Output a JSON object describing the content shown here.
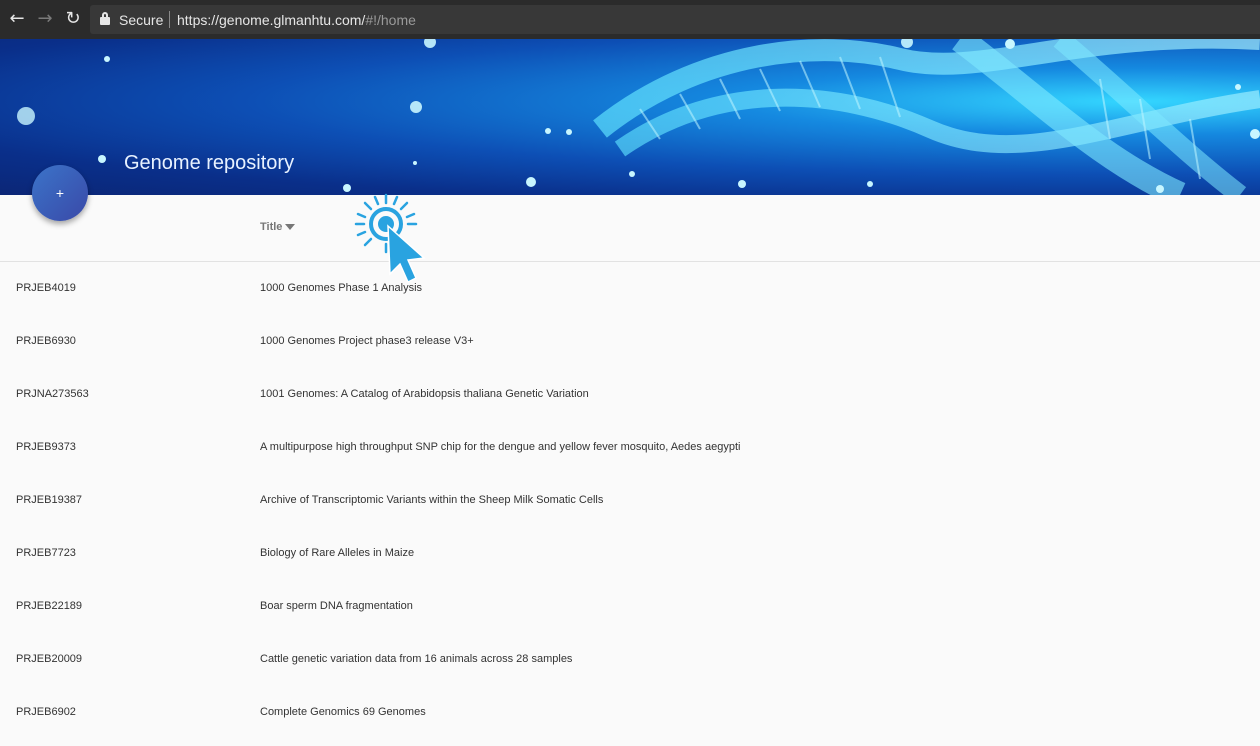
{
  "browser": {
    "secure_label": "Secure",
    "url_main": "https://genome.glmanhtu.com/",
    "url_hash": "#!/home"
  },
  "header": {
    "title": "Genome repository",
    "fab_label": "+"
  },
  "table": {
    "column_title": "Title",
    "rows": [
      {
        "id": "PRJEB4019",
        "title": "1000 Genomes Phase 1 Analysis"
      },
      {
        "id": "PRJEB6930",
        "title": "1000 Genomes Project phase3 release V3+"
      },
      {
        "id": "PRJNA273563",
        "title": "1001 Genomes: A Catalog of Arabidopsis thaliana Genetic Variation"
      },
      {
        "id": "PRJEB9373",
        "title": "A multipurpose high throughput SNP chip for the dengue and yellow fever mosquito, Aedes aegypti"
      },
      {
        "id": "PRJEB19387",
        "title": "Archive of Transcriptomic Variants within the Sheep Milk Somatic Cells"
      },
      {
        "id": "PRJEB7723",
        "title": "Biology of Rare Alleles in Maize"
      },
      {
        "id": "PRJEB22189",
        "title": "Boar sperm DNA fragmentation"
      },
      {
        "id": "PRJEB20009",
        "title": "Cattle genetic variation data from 16 animals across 28 samples"
      },
      {
        "id": "PRJEB6902",
        "title": "Complete Genomics 69 Genomes"
      }
    ]
  },
  "colors": {
    "banner_dark": "#0b2676",
    "banner_light": "#34d6ff",
    "fab": "#3a5bb8",
    "cursor": "#29a3e0"
  }
}
